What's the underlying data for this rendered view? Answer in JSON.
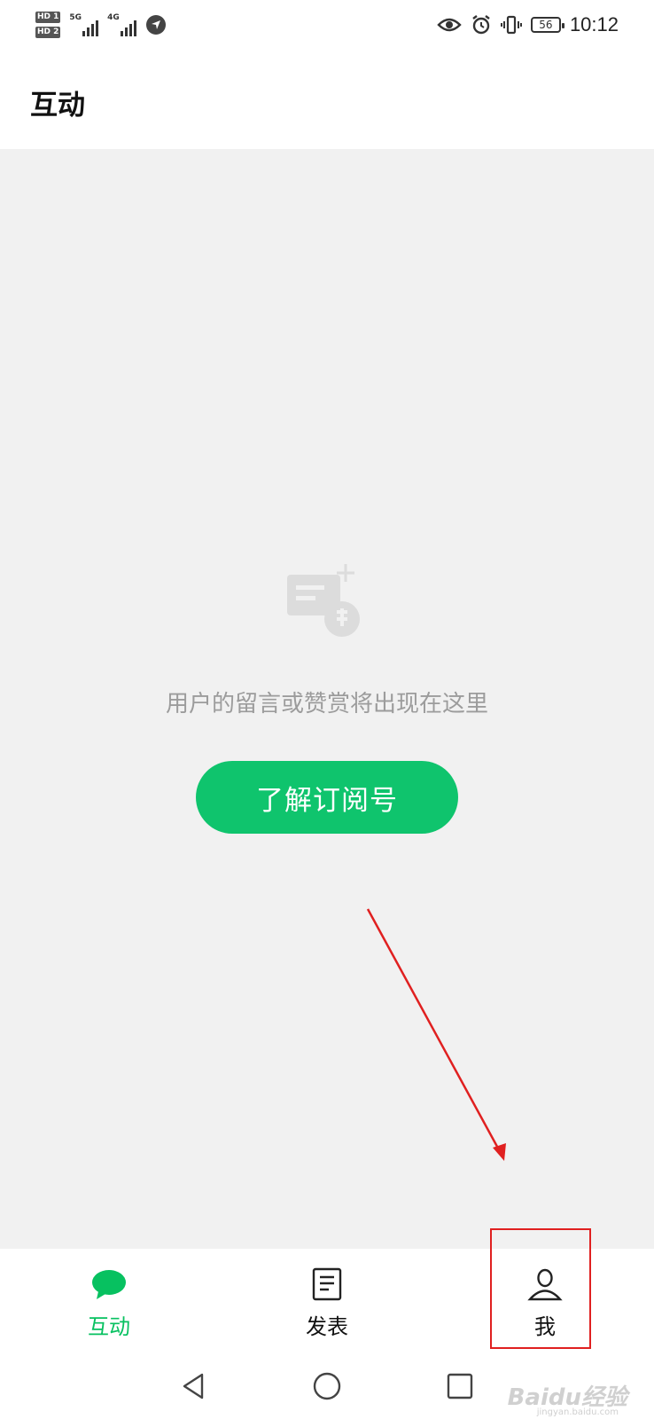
{
  "status_bar": {
    "sim1": "HD 1",
    "sim2": "HD 2",
    "net1": "5G",
    "net2": "4G",
    "battery": "56",
    "time": "10:12"
  },
  "header": {
    "title": "互动"
  },
  "empty_state": {
    "message": "用户的留言或赞赏将出现在这里",
    "cta_label": "了解订阅号"
  },
  "bottom_nav": {
    "items": [
      {
        "label": "互动",
        "icon": "chat-bubble-icon",
        "active": true
      },
      {
        "label": "发表",
        "icon": "document-icon",
        "active": false
      },
      {
        "label": "我",
        "icon": "person-icon",
        "active": false
      }
    ]
  },
  "colors": {
    "accent": "#07c160",
    "button": "#0fc46d",
    "annotation": "#e02020"
  },
  "watermark": {
    "brand": "Baidu经验",
    "url": "jingyan.baidu.com"
  }
}
